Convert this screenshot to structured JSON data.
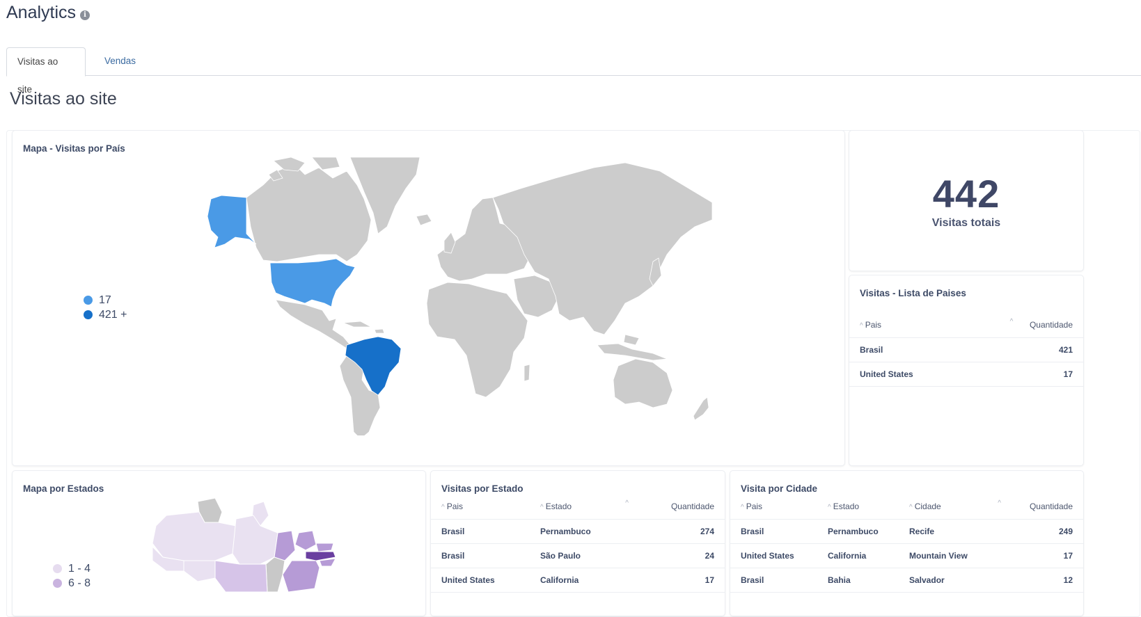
{
  "header": {
    "title": "Analytics",
    "info_icon": "info-icon",
    "info_glyph": "i"
  },
  "tabs": [
    {
      "label": "Visitas ao site",
      "active": true
    },
    {
      "label": "Vendas",
      "active": false
    }
  ],
  "section_title": "Visitas ao site",
  "map_country": {
    "title": "Mapa - Visitas por País",
    "legend": [
      {
        "label": "17",
        "color": "#4a9ae6"
      },
      {
        "label": "421 +",
        "color": "#1670c9"
      }
    ],
    "highlighted": [
      {
        "country": "United States",
        "color": "#4a9ae6"
      },
      {
        "country": "Brasil",
        "color": "#1670c9"
      }
    ],
    "base_color": "#cccccc"
  },
  "kpi": {
    "value": "442",
    "label": "Visitas totais"
  },
  "country_list": {
    "title": "Visitas - Lista de Paises",
    "headers": [
      "Pais",
      "Quantidade"
    ],
    "rows": [
      [
        "Brasil",
        "421"
      ],
      [
        "United States",
        "17"
      ]
    ]
  },
  "map_states": {
    "title": "Mapa por Estados",
    "legend": [
      {
        "label": "1 - 4",
        "color": "#e6dcef"
      },
      {
        "label": "6 - 8",
        "color": "#c9b3df"
      }
    ],
    "colors": {
      "lightest": "#e9e1f1",
      "light": "#d6c4e8",
      "medium": "#b69bd6",
      "dark": "#6a3fa0",
      "none": "#c8c8c8"
    }
  },
  "state_table": {
    "title": "Visitas por Estado",
    "headers": [
      "Pais",
      "Estado",
      "Quantidade"
    ],
    "rows": [
      [
        "Brasil",
        "Pernambuco",
        "274"
      ],
      [
        "Brasil",
        "São Paulo",
        "24"
      ],
      [
        "United States",
        "California",
        "17"
      ]
    ]
  },
  "city_table": {
    "title": "Visita por Cidade",
    "headers": [
      "Pais",
      "Estado",
      "Cidade",
      "Quantidade"
    ],
    "rows": [
      [
        "Brasil",
        "Pernambuco",
        "Recife",
        "249"
      ],
      [
        "United States",
        "California",
        "Mountain View",
        "17"
      ],
      [
        "Brasil",
        "Bahia",
        "Salvador",
        "12"
      ]
    ]
  }
}
